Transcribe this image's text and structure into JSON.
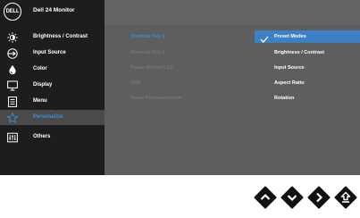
{
  "app": {
    "logo_text": "DELL",
    "title": "Dell 24 Monitor"
  },
  "sidebar": {
    "items": [
      {
        "label": "Brightness / Contrast",
        "icon": "brightness-icon"
      },
      {
        "label": "Input Source",
        "icon": "input-source-icon"
      },
      {
        "label": "Color",
        "icon": "color-icon"
      },
      {
        "label": "Display",
        "icon": "display-icon"
      },
      {
        "label": "Menu",
        "icon": "menu-icon"
      },
      {
        "label": "Personalize",
        "icon": "star-icon",
        "selected": true
      },
      {
        "label": "Others",
        "icon": "others-icon"
      }
    ]
  },
  "submenu": {
    "items": [
      {
        "label": "Shortcut Key 1",
        "selected": true
      },
      {
        "label": "Shortcut Key 2"
      },
      {
        "label": "Power Button LED"
      },
      {
        "label": "USB"
      },
      {
        "label": "Reset Personalization"
      }
    ]
  },
  "options": {
    "items": [
      {
        "label": "Preset Modes",
        "selected": true
      },
      {
        "label": "Brightness / Contrast"
      },
      {
        "label": "Input Source"
      },
      {
        "label": "Aspect Ratio"
      },
      {
        "label": "Rotation"
      }
    ]
  },
  "controls": {
    "buttons": [
      {
        "icon": "up-arrow-icon"
      },
      {
        "icon": "down-arrow-icon"
      },
      {
        "icon": "right-arrow-icon"
      },
      {
        "icon": "back-icon"
      }
    ]
  },
  "colors": {
    "accent": "#3a8fd6",
    "selection_band": "#3d81c4",
    "sidebar_bg": "#1d1d1d",
    "panel_bg": "#5e5e5e"
  }
}
